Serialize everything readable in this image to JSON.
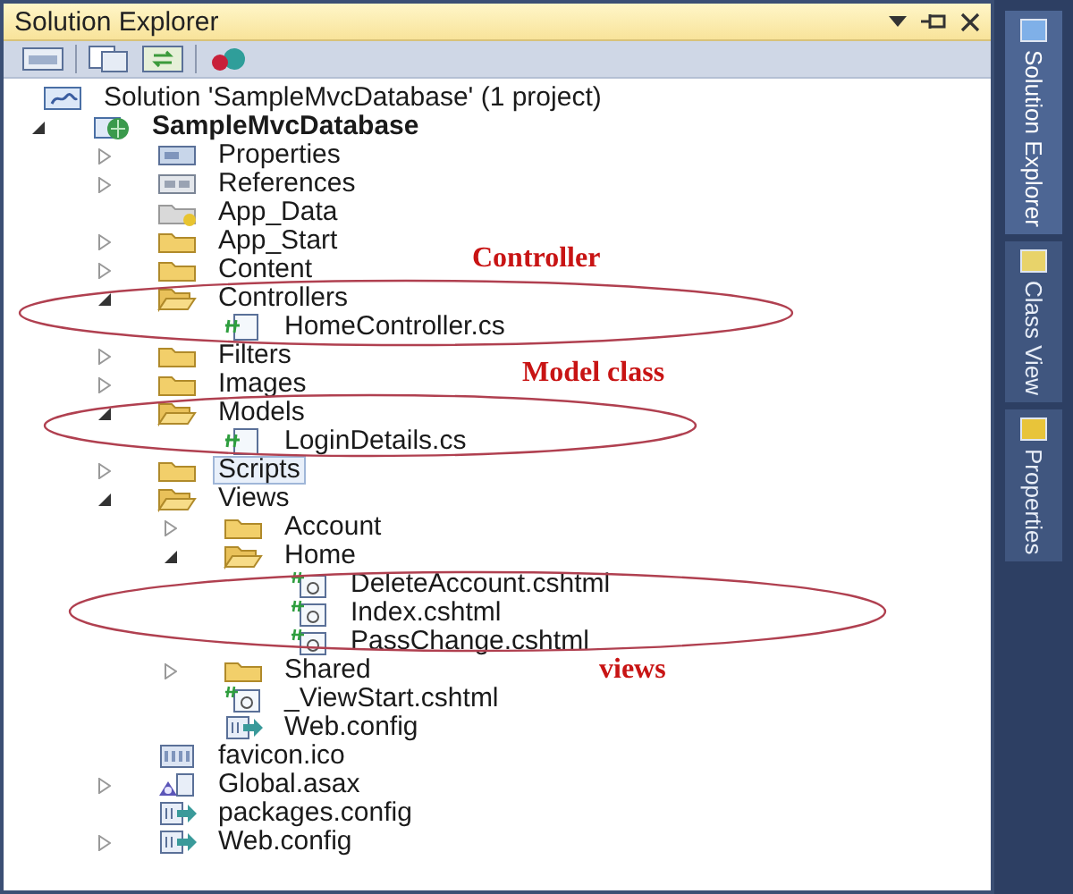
{
  "window": {
    "title": "Solution Explorer"
  },
  "tree": [
    {
      "label": "Solution 'SampleMvcDatabase' (1 project)",
      "kind": "solution",
      "selected": false,
      "children": [
        {
          "label": "SampleMvcDatabase",
          "kind": "project",
          "expanded": true,
          "selected": false,
          "children": [
            {
              "label": "Properties",
              "kind": "properties",
              "expanded": false,
              "selected": false
            },
            {
              "label": "References",
              "kind": "references",
              "expanded": false,
              "selected": false
            },
            {
              "label": "App_Data",
              "kind": "datafolder",
              "selected": false
            },
            {
              "label": "App_Start",
              "kind": "folder",
              "expanded": false,
              "selected": false
            },
            {
              "label": "Content",
              "kind": "folder",
              "expanded": false,
              "selected": false
            },
            {
              "label": "Controllers",
              "kind": "folder",
              "expanded": true,
              "selected": false,
              "children": [
                {
                  "label": "HomeController.cs",
                  "kind": "cs",
                  "selected": false
                }
              ]
            },
            {
              "label": "Filters",
              "kind": "folder",
              "expanded": false,
              "selected": false
            },
            {
              "label": "Images",
              "kind": "folder",
              "expanded": false,
              "selected": false
            },
            {
              "label": "Models",
              "kind": "folder",
              "expanded": true,
              "selected": false,
              "children": [
                {
                  "label": "LoginDetails.cs",
                  "kind": "cs",
                  "selected": false
                }
              ]
            },
            {
              "label": "Scripts",
              "kind": "folder",
              "expanded": false,
              "selected": true
            },
            {
              "label": "Views",
              "kind": "folder",
              "expanded": true,
              "selected": false,
              "children": [
                {
                  "label": "Account",
                  "kind": "folder",
                  "expanded": false,
                  "selected": false
                },
                {
                  "label": "Home",
                  "kind": "folder",
                  "expanded": true,
                  "selected": false,
                  "children": [
                    {
                      "label": "DeleteAccount.cshtml",
                      "kind": "cshtml",
                      "selected": false
                    },
                    {
                      "label": "Index.cshtml",
                      "kind": "cshtml",
                      "selected": false
                    },
                    {
                      "label": "PassChange.cshtml",
                      "kind": "cshtml",
                      "selected": false
                    }
                  ]
                },
                {
                  "label": "Shared",
                  "kind": "folder",
                  "expanded": false,
                  "selected": false
                },
                {
                  "label": "_ViewStart.cshtml",
                  "kind": "cshtml",
                  "selected": false
                },
                {
                  "label": "Web.config",
                  "kind": "config",
                  "selected": false
                }
              ]
            },
            {
              "label": "favicon.ico",
              "kind": "ico",
              "selected": false
            },
            {
              "label": "Global.asax",
              "kind": "asax",
              "expanded": false,
              "selected": false
            },
            {
              "label": "packages.config",
              "kind": "config",
              "selected": false
            },
            {
              "label": "Web.config",
              "kind": "config",
              "expanded": false,
              "selected": false
            }
          ]
        }
      ]
    }
  ],
  "annotations": [
    {
      "text": "Controller"
    },
    {
      "text": "Model class"
    },
    {
      "text": "views"
    }
  ],
  "side_tabs": [
    {
      "label": "Solution Explorer",
      "kind": "solution",
      "selected": true
    },
    {
      "label": "Class View",
      "kind": "class",
      "selected": false
    },
    {
      "label": "Properties",
      "kind": "properties",
      "selected": false
    }
  ]
}
